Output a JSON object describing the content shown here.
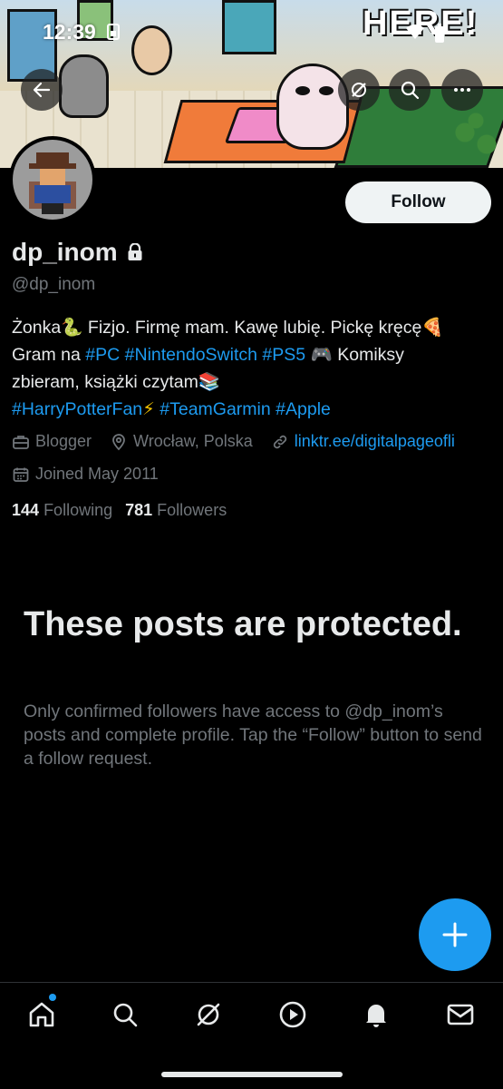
{
  "status": {
    "time": "12:39"
  },
  "banner": {
    "sign_text": "HERE!"
  },
  "header": {
    "back_label": "Back",
    "icons": [
      "back-arrow-icon",
      "grok-icon",
      "search-icon",
      "more-icon"
    ]
  },
  "profile": {
    "follow_label": "Follow",
    "name": "dp_inom",
    "handle": "@dp_inom",
    "bio": {
      "line1_a": "Żonka",
      "line1_b": " Fizjo. Firmę mam. Kawę lubię. Pickę kręcę",
      "line2_a": "Gram na ",
      "tag_pc": "#PC",
      "tag_switch": "#NintendoSwitch",
      "tag_ps5": "#PS5",
      "line2_b": " Komiksy",
      "line3": "zbieram, książki czytam",
      "tag_hp": "#HarryPotterFan",
      "tag_garmin": "#TeamGarmin",
      "tag_apple": "#Apple"
    },
    "category": "Blogger",
    "location": "Wrocław, Polska",
    "link": "linktr.ee/digitalpageofli",
    "joined": "Joined May 2011",
    "following_count": "144",
    "following_label": "Following",
    "followers_count": "781",
    "followers_label": "Followers"
  },
  "protected": {
    "title": "These posts are protected.",
    "text": "Only confirmed followers have access to @dp_inom’s posts and complete profile. Tap the “Follow” button to send a follow request."
  },
  "tabbar": {
    "items": [
      "home-icon",
      "search-icon",
      "grok-icon",
      "video-icon",
      "notifications-icon",
      "messages-icon"
    ]
  },
  "colors": {
    "accent": "#1d9bf0",
    "background": "#000000",
    "muted": "#71767b"
  }
}
